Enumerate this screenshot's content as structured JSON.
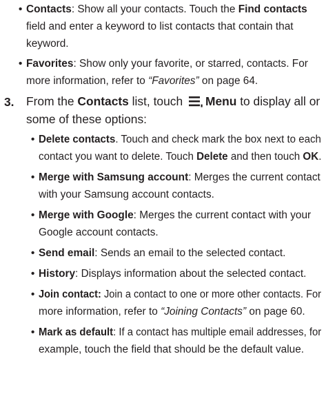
{
  "contacts_item": {
    "term": "Contacts",
    "text1": ": Show all your contacts. Touch the ",
    "find_term": "Find contacts",
    "text2": "field and enter a keyword to list contacts that contain that",
    "text3": "keyword."
  },
  "favorites_item": {
    "term": "Favorites",
    "text1": ": Show only your favorite, or starred, contacts. For",
    "text2": "more information, refer to ",
    "ref": "“Favorites”",
    "page": " on page 64."
  },
  "step3": {
    "number": "3.",
    "pre": "From the ",
    "contacts_term": "Contacts",
    "mid": " list, touch ",
    "menu_icon": "menu-icon",
    "menu_term": "Menu",
    "post": " to display all or",
    "line2": "some of these options:"
  },
  "options": {
    "delete": {
      "term": "Delete contacts",
      "text1": ". Touch and check mark the box next to each",
      "text2a": "contact you want to delete. Touch ",
      "delete_term": "Delete",
      "text2b": " and then touch ",
      "ok_term": "OK",
      "text2c": "."
    },
    "merge_samsung": {
      "term": "Merge with Samsung account",
      "text1": ": Merges the current contact",
      "text2": "with your Samsung account contacts."
    },
    "merge_google": {
      "term": "Merge with Google",
      "text1": ": Merges the current contact with your",
      "text2": "Google account contacts."
    },
    "send_email": {
      "term": "Send email",
      "text1": ": Sends an email to the selected contact."
    },
    "history": {
      "term": "History",
      "text1": ": Displays information about the selected contact."
    },
    "join": {
      "term": "Join contact:",
      "text1": " Join a contact to one or more other contacts. For",
      "text2": "more information, refer to ",
      "ref": "“Joining Contacts”",
      "page": " on page 60."
    },
    "default": {
      "term": "Mark as default",
      "text1": ": If a contact has multiple email addresses, for",
      "text2": "example, touch the field that should be the default value."
    }
  }
}
